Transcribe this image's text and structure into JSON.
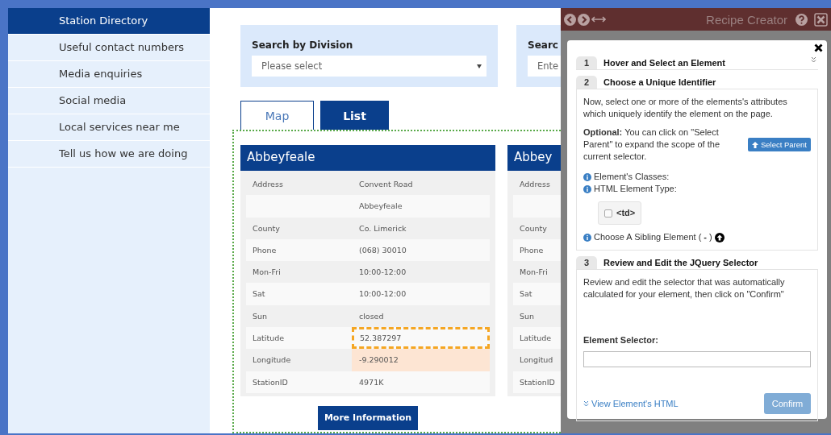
{
  "sidebar": {
    "items": [
      {
        "label": "Station Directory",
        "selected": true
      },
      {
        "label": "Useful contact numbers",
        "selected": false
      },
      {
        "label": "Media enquiries",
        "selected": false
      },
      {
        "label": "Social media",
        "selected": false
      },
      {
        "label": "Local services near me",
        "selected": false
      },
      {
        "label": "Tell us how we are doing",
        "selected": false
      }
    ]
  },
  "search": [
    {
      "label": "Search by Division",
      "kind": "select",
      "placeholder": "Please select"
    },
    {
      "label": "Searc",
      "kind": "text",
      "placeholder": "Ente"
    }
  ],
  "tabs": [
    {
      "label": "Map",
      "selected": false
    },
    {
      "label": "List",
      "selected": true
    }
  ],
  "cards": [
    {
      "title": "Abbeyfeale",
      "button": "More Information",
      "rows": [
        {
          "label": "Address",
          "value": "Convent Road",
          "outlined": false,
          "tinted": false
        },
        {
          "value": "Abbeyfeale",
          "outlined": false,
          "tinted": false
        },
        {
          "label": "County",
          "value": "Co. Limerick",
          "outlined": false,
          "tinted": false
        },
        {
          "label": "Phone",
          "value": "(068) 30010",
          "outlined": false,
          "tinted": false
        },
        {
          "label": "Mon-Fri",
          "value": "10:00-12:00",
          "outlined": false,
          "tinted": false
        },
        {
          "label": "Sat",
          "value": "10:00-12:00",
          "outlined": false,
          "tinted": false
        },
        {
          "label": "Sun",
          "value": "closed",
          "outlined": false,
          "tinted": false
        },
        {
          "label": "Latitude",
          "value": "52.387297",
          "outlined": true,
          "tinted": false
        },
        {
          "label": "Longitude",
          "value": "-9.290012",
          "outlined": false,
          "tinted": true
        },
        {
          "label": "StationID",
          "value": "4971K",
          "outlined": false,
          "tinted": false
        }
      ]
    },
    {
      "title": "Abbey",
      "rows": [
        {
          "label": "Address"
        },
        {},
        {
          "label": "County"
        },
        {
          "label": "Phone"
        },
        {
          "label": "Mon-Fri"
        },
        {
          "label": "Sat"
        },
        {
          "label": "Sun"
        },
        {
          "label": "Latitude"
        },
        {
          "label": "Longitud"
        },
        {
          "label": "StationID"
        }
      ]
    }
  ],
  "recipe": {
    "title": "Recipe Creator",
    "steps": [
      {
        "number": "1",
        "title": "Hover and Select an Element",
        "expanded": false
      },
      {
        "number": "2",
        "title": "Choose a Unique Identifier",
        "expanded": true,
        "kind": "identifier",
        "intro": "Now, select one or more of the elements's attributes which uniquely identify the element on the page.",
        "optional": "**Optional:** You can click on \"Select Parent\" to expand the scope of the current selector.",
        "parent_button": "Select Parent",
        "info": [
          "Element's Classes:",
          "HTML Element Type:"
        ],
        "element_type": {
          "label": "<td>",
          "checked": false
        },
        "sibling": "Choose A Sibling Element ( **-** )"
      },
      {
        "number": "3",
        "title": "Review and Edit the JQuery Selector",
        "expanded": true,
        "kind": "selector",
        "intro": "Review and edit the selector that was automatically calculated for your element, then click on \"Confirm\"",
        "field_label": "Element Selector:",
        "html_link": "View Element's HTML",
        "confirm": "Confirm",
        "confirm_disabled": true
      }
    ]
  }
}
